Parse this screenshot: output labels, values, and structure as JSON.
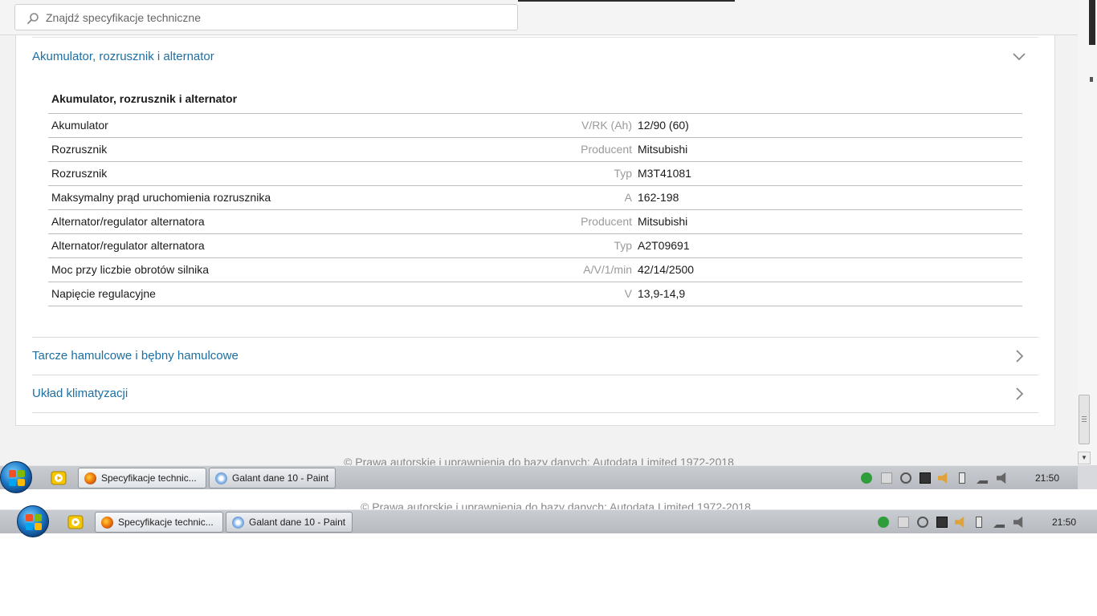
{
  "search": {
    "placeholder": "Znajdź specyfikacje techniczne"
  },
  "sections": {
    "open": {
      "title": "Akumulator, rozrusznik i alternator"
    },
    "brakes": {
      "title": "Tarcze hamulcowe i bębny hamulcowe"
    },
    "ac": {
      "title": "Układ klimatyzacji"
    }
  },
  "spec": {
    "title": "Akumulator, rozrusznik i alternator",
    "rows": [
      {
        "name": "Akumulator",
        "unit": "V/RK (Ah)",
        "value": "12/90 (60)"
      },
      {
        "name": "Rozrusznik",
        "unit": "Producent",
        "value": "Mitsubishi"
      },
      {
        "name": "Rozrusznik",
        "unit": "Typ",
        "value": "M3T41081"
      },
      {
        "name": "Maksymalny prąd uruchomienia rozrusznika",
        "unit": "A",
        "value": "162-198"
      },
      {
        "name": "Alternator/regulator alternatora",
        "unit": "Producent",
        "value": "Mitsubishi"
      },
      {
        "name": "Alternator/regulator alternatora",
        "unit": "Typ",
        "value": "A2T09691"
      },
      {
        "name": "Moc przy liczbie obrotów silnika",
        "unit": "A/V/1/min",
        "value": "42/14/2500"
      },
      {
        "name": "Napięcie regulacyjne",
        "unit": "V",
        "value": "13,9-14,9"
      }
    ]
  },
  "footer": {
    "copyright": "© Prawa autorskie i uprawnienia do bazy danych: Autodata Limited 1972-2018"
  },
  "taskbar": {
    "items": [
      {
        "label": "Specyfikacje technic...",
        "icon": "firefox-icon"
      },
      {
        "label": "Galant dane 10 - Paint",
        "icon": "paint-icon"
      }
    ],
    "clock": "21:50"
  },
  "colors": {
    "link": "#1c6fa3",
    "unit": "#9a9a9a",
    "divider": "#bcbcbc"
  }
}
